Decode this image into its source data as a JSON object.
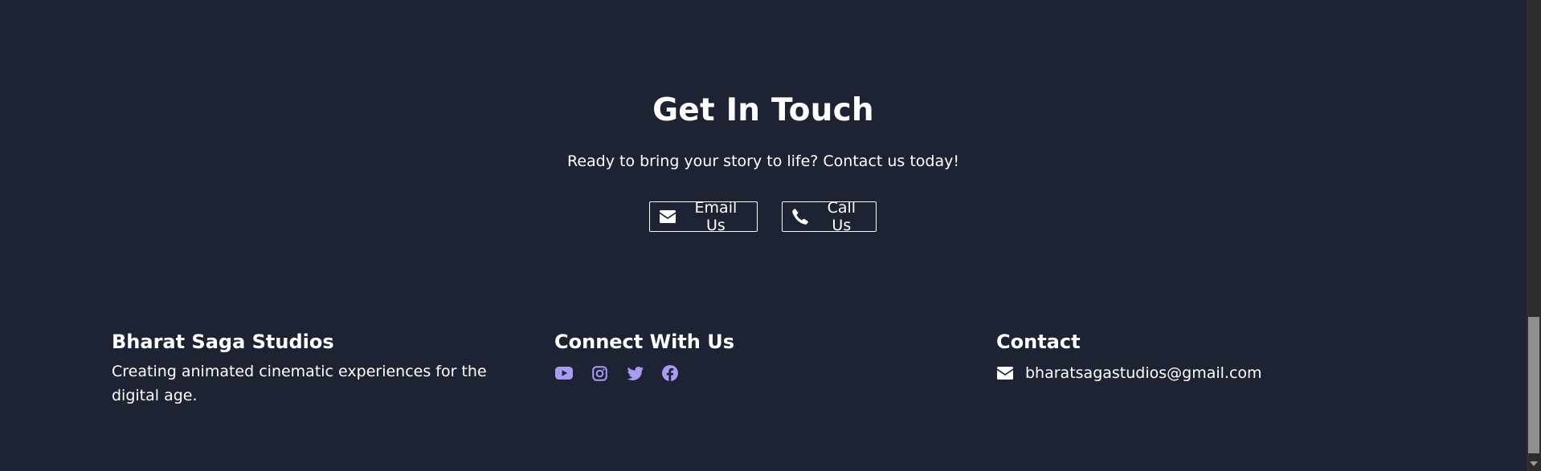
{
  "contact_section": {
    "title": "Get In Touch",
    "subtitle": "Ready to bring your story to life? Contact us today!",
    "email_button": {
      "label": "Email Us",
      "icon": "envelope-icon"
    },
    "call_button": {
      "label": "Call Us",
      "icon": "phone-icon"
    }
  },
  "footer": {
    "brand": {
      "heading": "Bharat Saga Studios",
      "description": "Creating animated cinematic experiences for the digital age."
    },
    "social": {
      "heading": "Connect With Us",
      "icons": [
        "youtube-icon",
        "instagram-icon",
        "twitter-icon",
        "facebook-icon"
      ],
      "icon_color": "#a99bf3"
    },
    "contact": {
      "heading": "Contact",
      "email": "bharatsagastudios@gmail.com",
      "icon": "envelope-icon"
    }
  },
  "colors": {
    "background": "#1e2334",
    "text": "#ffffff",
    "accent": "#a99bf3"
  }
}
